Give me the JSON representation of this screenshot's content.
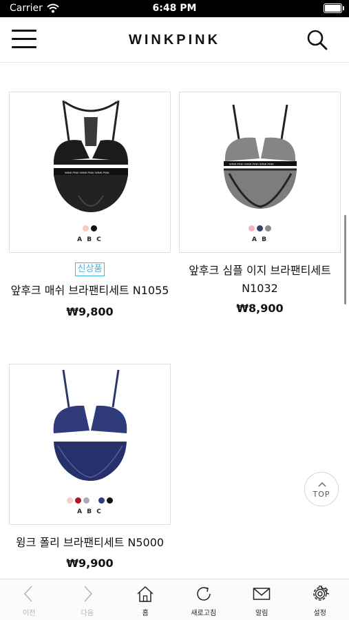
{
  "status_bar": {
    "carrier": "Carrier",
    "time": "6:48 PM"
  },
  "header": {
    "brand": "WINKPINK"
  },
  "products": [
    {
      "name": "앞후크 매쉬 브라팬티세트 N1055",
      "price": "₩9,800",
      "badge": "신상품",
      "variant_letters": "A B C",
      "swatches": [
        "#f6c9c4",
        "#111111"
      ]
    },
    {
      "name": "앞후크 심플 이지 브라팬티세트 N1032",
      "price": "₩8,900",
      "variant_letters": "A B",
      "swatches": [
        "#f2b6bd",
        "#3b3f66",
        "#8a8a8a"
      ]
    },
    {
      "name": "윙크 폴리 브라팬티세트 N5000",
      "price": "₩9,900",
      "variant_letters": "A B C",
      "swatches": [
        "#f7cfc6",
        "#b5122a",
        "#a9acb5",
        "#2f3b7a",
        "#111111"
      ]
    }
  ],
  "top_button": {
    "label": "TOP"
  },
  "bottom_nav": [
    {
      "label": "이전",
      "icon": "back-arrow-icon",
      "enabled": false
    },
    {
      "label": "다음",
      "icon": "forward-arrow-icon",
      "enabled": false
    },
    {
      "label": "홈",
      "icon": "home-icon",
      "enabled": true
    },
    {
      "label": "새로고침",
      "icon": "refresh-icon",
      "enabled": true
    },
    {
      "label": "알림",
      "icon": "mail-icon",
      "enabled": true
    },
    {
      "label": "설정",
      "icon": "gear-icon",
      "enabled": true
    }
  ]
}
